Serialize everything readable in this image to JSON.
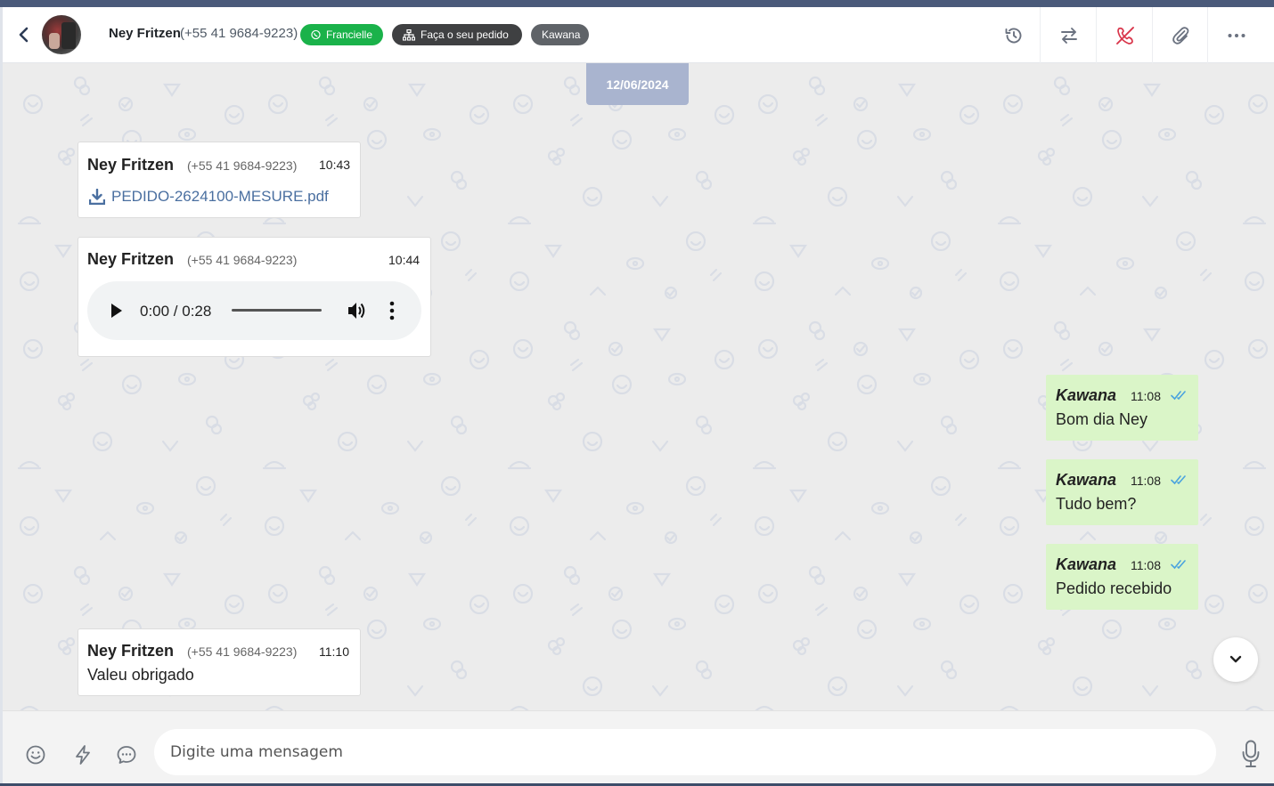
{
  "header": {
    "contact_name": "Ney Fritzen",
    "contact_phone": "(+55 41 9684-9223)",
    "tags": [
      {
        "label": "Francielle",
        "color": "#1ab24a",
        "icon": "whatsapp-icon"
      },
      {
        "label": "Faça o seu pedido",
        "color": "#3f4042",
        "icon": "sitemap-icon"
      },
      {
        "label": "Kawana",
        "color": "#5f6368"
      }
    ],
    "actions": [
      "history-icon",
      "transfer-icon",
      "end-call-icon",
      "attachment-icon",
      "more-icon"
    ]
  },
  "chat": {
    "date": "12/06/2024",
    "messages_in": [
      {
        "name": "Ney Fritzen",
        "phone": "(+55 41 9684-9223)",
        "time": "10:43",
        "file": "PEDIDO-2624100-MESURE.pdf"
      },
      {
        "name": "Ney Fritzen",
        "phone": "(+55 41 9684-9223)",
        "time": "10:44",
        "audio_time": "0:00 / 0:28"
      },
      {
        "name": "Ney Fritzen",
        "phone": "(+55 41 9684-9223)",
        "time": "11:10",
        "text": "Valeu obrigado"
      }
    ],
    "messages_out": [
      {
        "name": "Kawana",
        "time": "11:08",
        "text": "Bom dia Ney"
      },
      {
        "name": "Kawana",
        "time": "11:08",
        "text": "Tudo bem?"
      },
      {
        "name": "Kawana",
        "time": "11:08",
        "text": "Pedido recebido"
      }
    ]
  },
  "footer": {
    "input_placeholder": "Digite uma mensagem"
  },
  "colors": {
    "accent_green": "#1ab24a",
    "outgoing_bubble": "#daf5c8",
    "date_chip": "#a9b4cf",
    "check_blue": "#4aa3df",
    "end_call_red": "#d9364b"
  }
}
